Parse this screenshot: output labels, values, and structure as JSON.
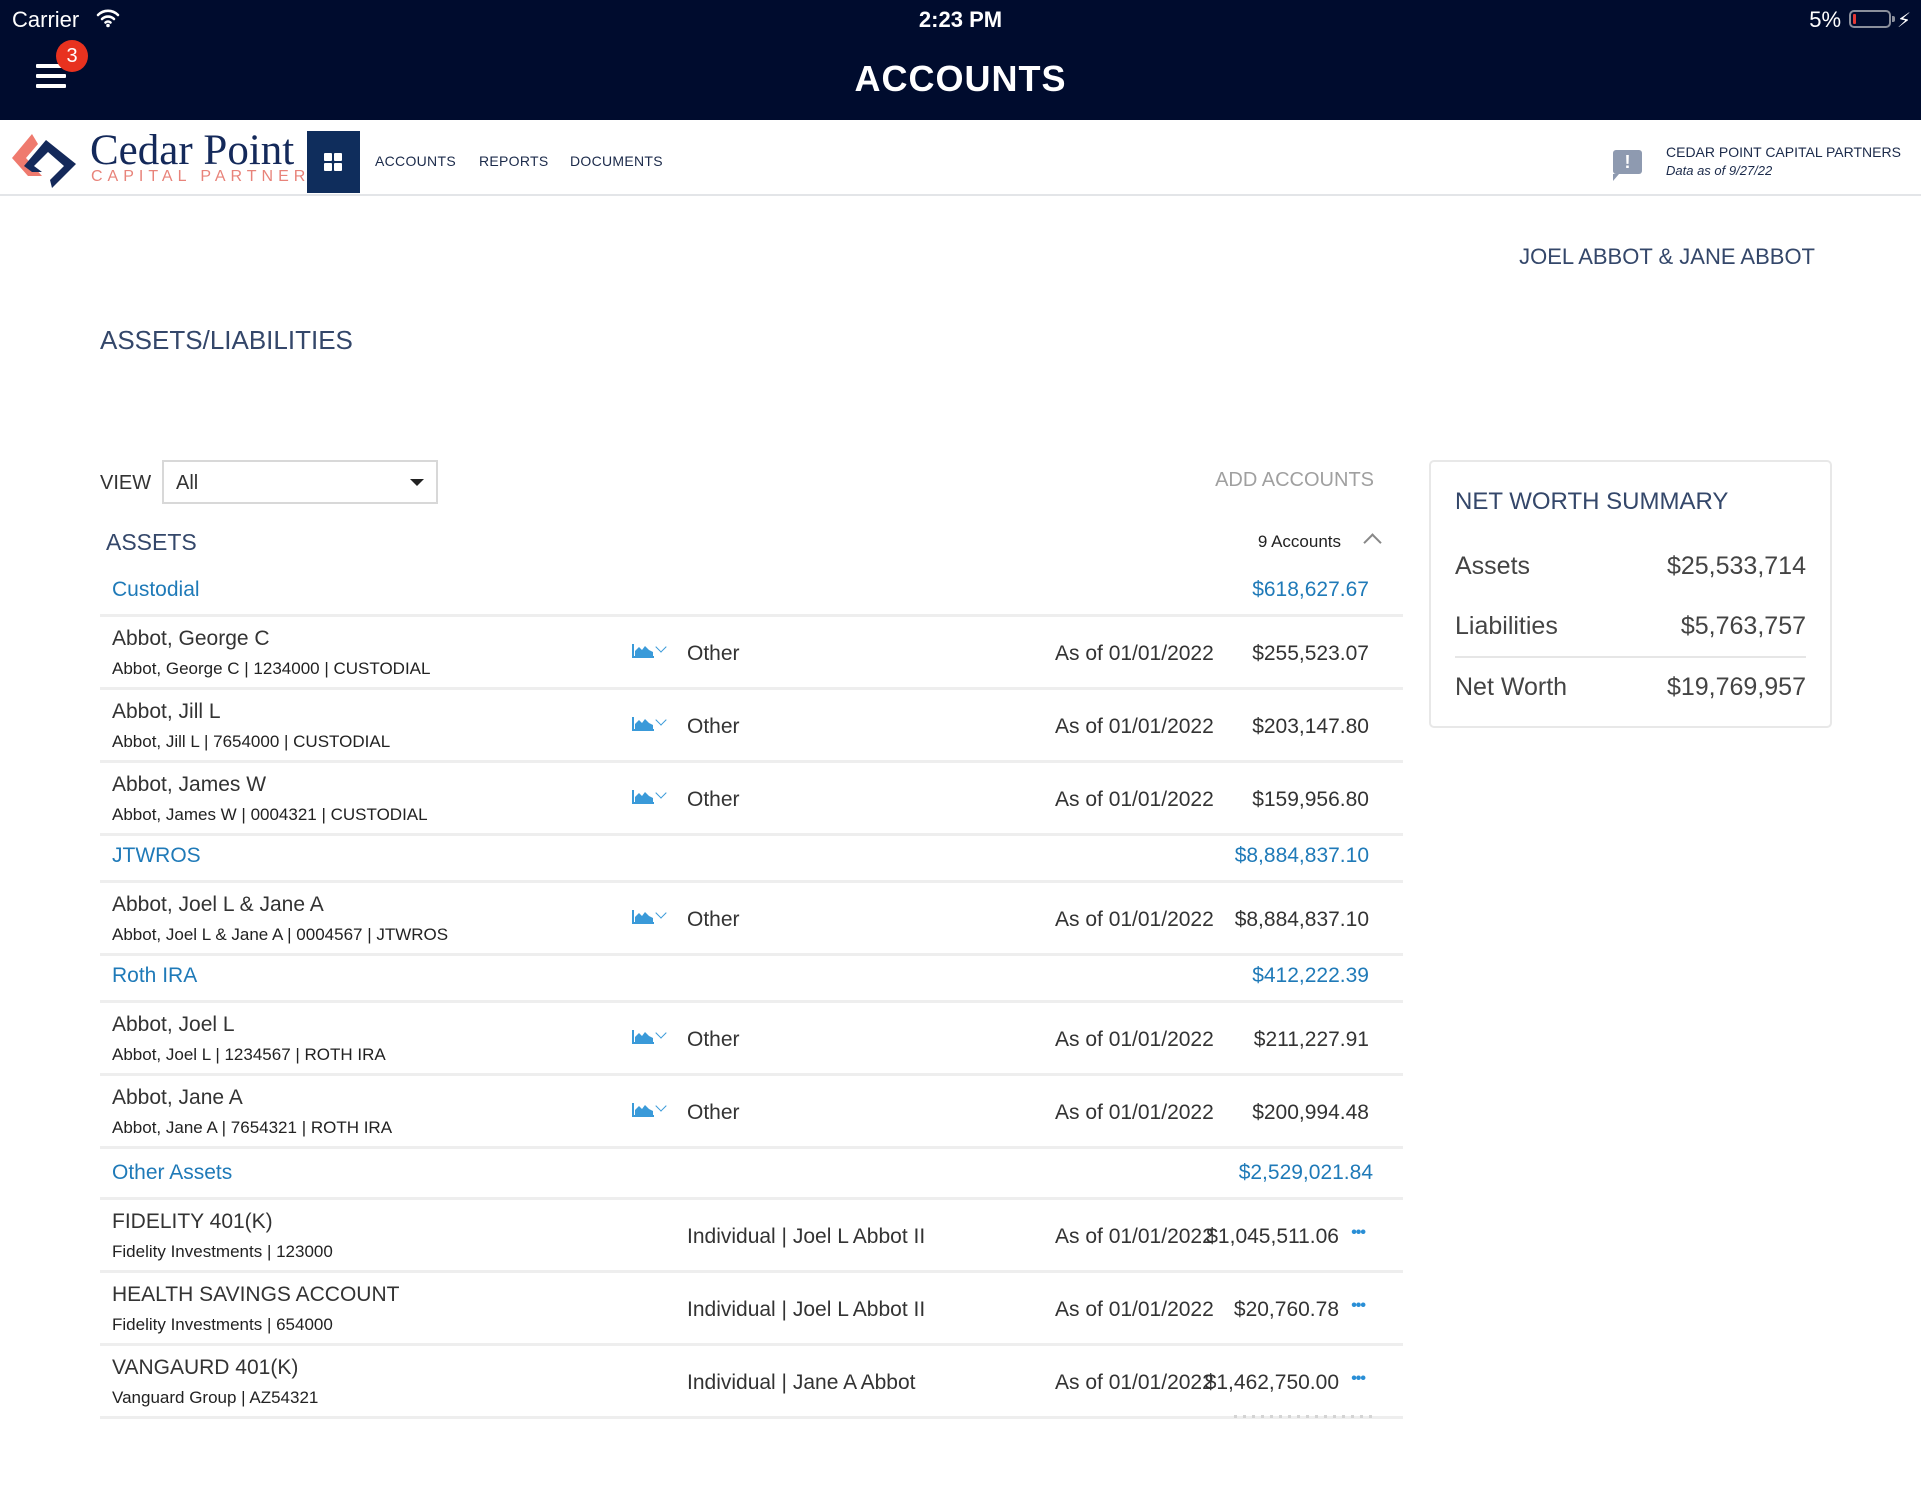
{
  "status_bar": {
    "carrier": "Carrier",
    "time": "2:23 PM",
    "battery_percent": "5%",
    "battery_level": 0.05
  },
  "app_header": {
    "title": "ACCOUNTS",
    "menu_badge_count": "3",
    "colors": {
      "header_bg": "#000c2e",
      "badge": "#e8321f"
    }
  },
  "nav": {
    "brand_name": "Cedar Point",
    "brand_sub": "CAPITAL PARTNERS",
    "links": [
      {
        "label": "ACCOUNTS"
      },
      {
        "label": "REPORTS"
      },
      {
        "label": "DOCUMENTS"
      }
    ],
    "firm_name": "CEDAR POINT CAPITAL PARTNERS",
    "data_as_of": "Data as of 9/27/22"
  },
  "main": {
    "client_name": "JOEL ABBOT & JANE ABBOT",
    "page_heading": "ASSETS/LIABILITIES",
    "view_label": "VIEW",
    "view_selected": "All",
    "add_accounts_label": "ADD ACCOUNTS",
    "section_title": "ASSETS",
    "account_count": "9 Accounts",
    "colors": {
      "link_blue": "#1f7ab8",
      "heading": "#34476a"
    },
    "categories": [
      {
        "name": "Custodial",
        "total": "$618,627.67",
        "accounts": [
          {
            "name": "Abbot, George C",
            "detail": "Abbot, George C | 1234000 | CUSTODIAL",
            "type": "Other",
            "as_of": "As of 01/01/2022",
            "amount": "$255,523.07"
          },
          {
            "name": "Abbot, Jill L",
            "detail": "Abbot, Jill L | 7654000 | CUSTODIAL",
            "type": "Other",
            "as_of": "As of 01/01/2022",
            "amount": "$203,147.80"
          },
          {
            "name": "Abbot, James W",
            "detail": "Abbot, James W | 0004321 | CUSTODIAL",
            "type": "Other",
            "as_of": "As of 01/01/2022",
            "amount": "$159,956.80"
          }
        ]
      },
      {
        "name": "JTWROS",
        "total": "$8,884,837.10",
        "accounts": [
          {
            "name": "Abbot, Joel L & Jane A",
            "detail": "Abbot, Joel L & Jane A | 0004567 | JTWROS",
            "type": "Other",
            "as_of": "As of 01/01/2022",
            "amount": "$8,884,837.10"
          }
        ]
      },
      {
        "name": "Roth IRA",
        "total": "$412,222.39",
        "accounts": [
          {
            "name": "Abbot, Joel L",
            "detail": "Abbot, Joel L | 1234567 | ROTH IRA",
            "type": "Other",
            "as_of": "As of 01/01/2022",
            "amount": "$211,227.91"
          },
          {
            "name": "Abbot, Jane A",
            "detail": "Abbot, Jane A | 7654321 | ROTH IRA",
            "type": "Other",
            "as_of": "As of 01/01/2022",
            "amount": "$200,994.48"
          }
        ]
      },
      {
        "name": "Other Assets",
        "total": "$2,529,021.84",
        "accounts": [
          {
            "name": "FIDELITY 401(K)",
            "detail": "Fidelity Investments | 123000",
            "type": "Individual | Joel L Abbot II",
            "as_of": "As of 01/01/2022",
            "amount": "$1,045,511.06",
            "more": "•••"
          },
          {
            "name": "HEALTH SAVINGS ACCOUNT",
            "detail": "Fidelity Investments | 654000",
            "type": "Individual | Joel L Abbot II",
            "as_of": "As of 01/01/2022",
            "amount": "$20,760.78",
            "more": "•••"
          },
          {
            "name": "VANGAURD 401(K)",
            "detail": "Vanguard Group | AZ54321",
            "type": "Individual | Jane A Abbot",
            "as_of": "As of 01/01/2022",
            "amount": "$1,462,750.00",
            "more": "•••"
          }
        ]
      }
    ]
  },
  "net_worth": {
    "title": "NET WORTH SUMMARY",
    "assets_label": "Assets",
    "assets_value": "$25,533,714",
    "liabilities_label": "Liabilities",
    "liabilities_value": "$5,763,757",
    "net_worth_label": "Net Worth",
    "net_worth_value": "$19,769,957"
  }
}
